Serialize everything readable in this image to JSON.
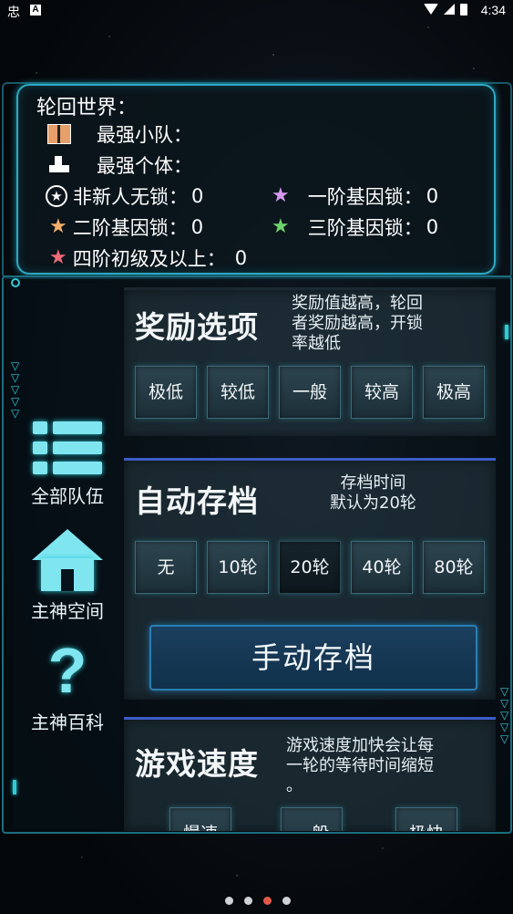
{
  "status_bar": {
    "left_icon": "忠",
    "app_badge": "A",
    "time": "4:34"
  },
  "world": {
    "title": "轮回世界：",
    "strongest_team_label": "最强小队：",
    "strongest_individual_label": "最强个体：",
    "stats": [
      {
        "label": "非新人无锁：",
        "value": "0",
        "star_color": "#ffffff"
      },
      {
        "label": "一阶基因锁：",
        "value": "0",
        "star_color": "#d59af0"
      },
      {
        "label": "二阶基因锁：",
        "value": "0",
        "star_color": "#f2b06a"
      },
      {
        "label": "三阶基因锁：",
        "value": "0",
        "star_color": "#6ed36a"
      },
      {
        "label": "四阶初级及以上：",
        "value": "0",
        "star_color": "#f06a7a"
      }
    ]
  },
  "nav": {
    "all_teams": "全部队伍",
    "home_space": "主神空间",
    "encyclopedia": "主神百科"
  },
  "reward": {
    "title": "奖励选项",
    "desc": [
      "奖励值越高，轮回",
      "者奖励越高，开锁",
      "率越低"
    ],
    "options": [
      "极低",
      "较低",
      "一般",
      "较高",
      "极高"
    ]
  },
  "autosave": {
    "title": "自动存档",
    "desc": [
      "存档时间",
      "默认为20轮"
    ],
    "options": [
      "无",
      "10轮",
      "20轮",
      "40轮",
      "80轮"
    ],
    "selected": "20轮",
    "manual_button": "手动存档"
  },
  "speed": {
    "title": "游戏速度",
    "desc": [
      "游戏速度加快会让每",
      "一轮的等待时间缩短",
      "。"
    ],
    "options": [
      "慢速",
      "一般",
      "极快"
    ]
  },
  "pager": {
    "count": 4,
    "active_index": 2
  }
}
